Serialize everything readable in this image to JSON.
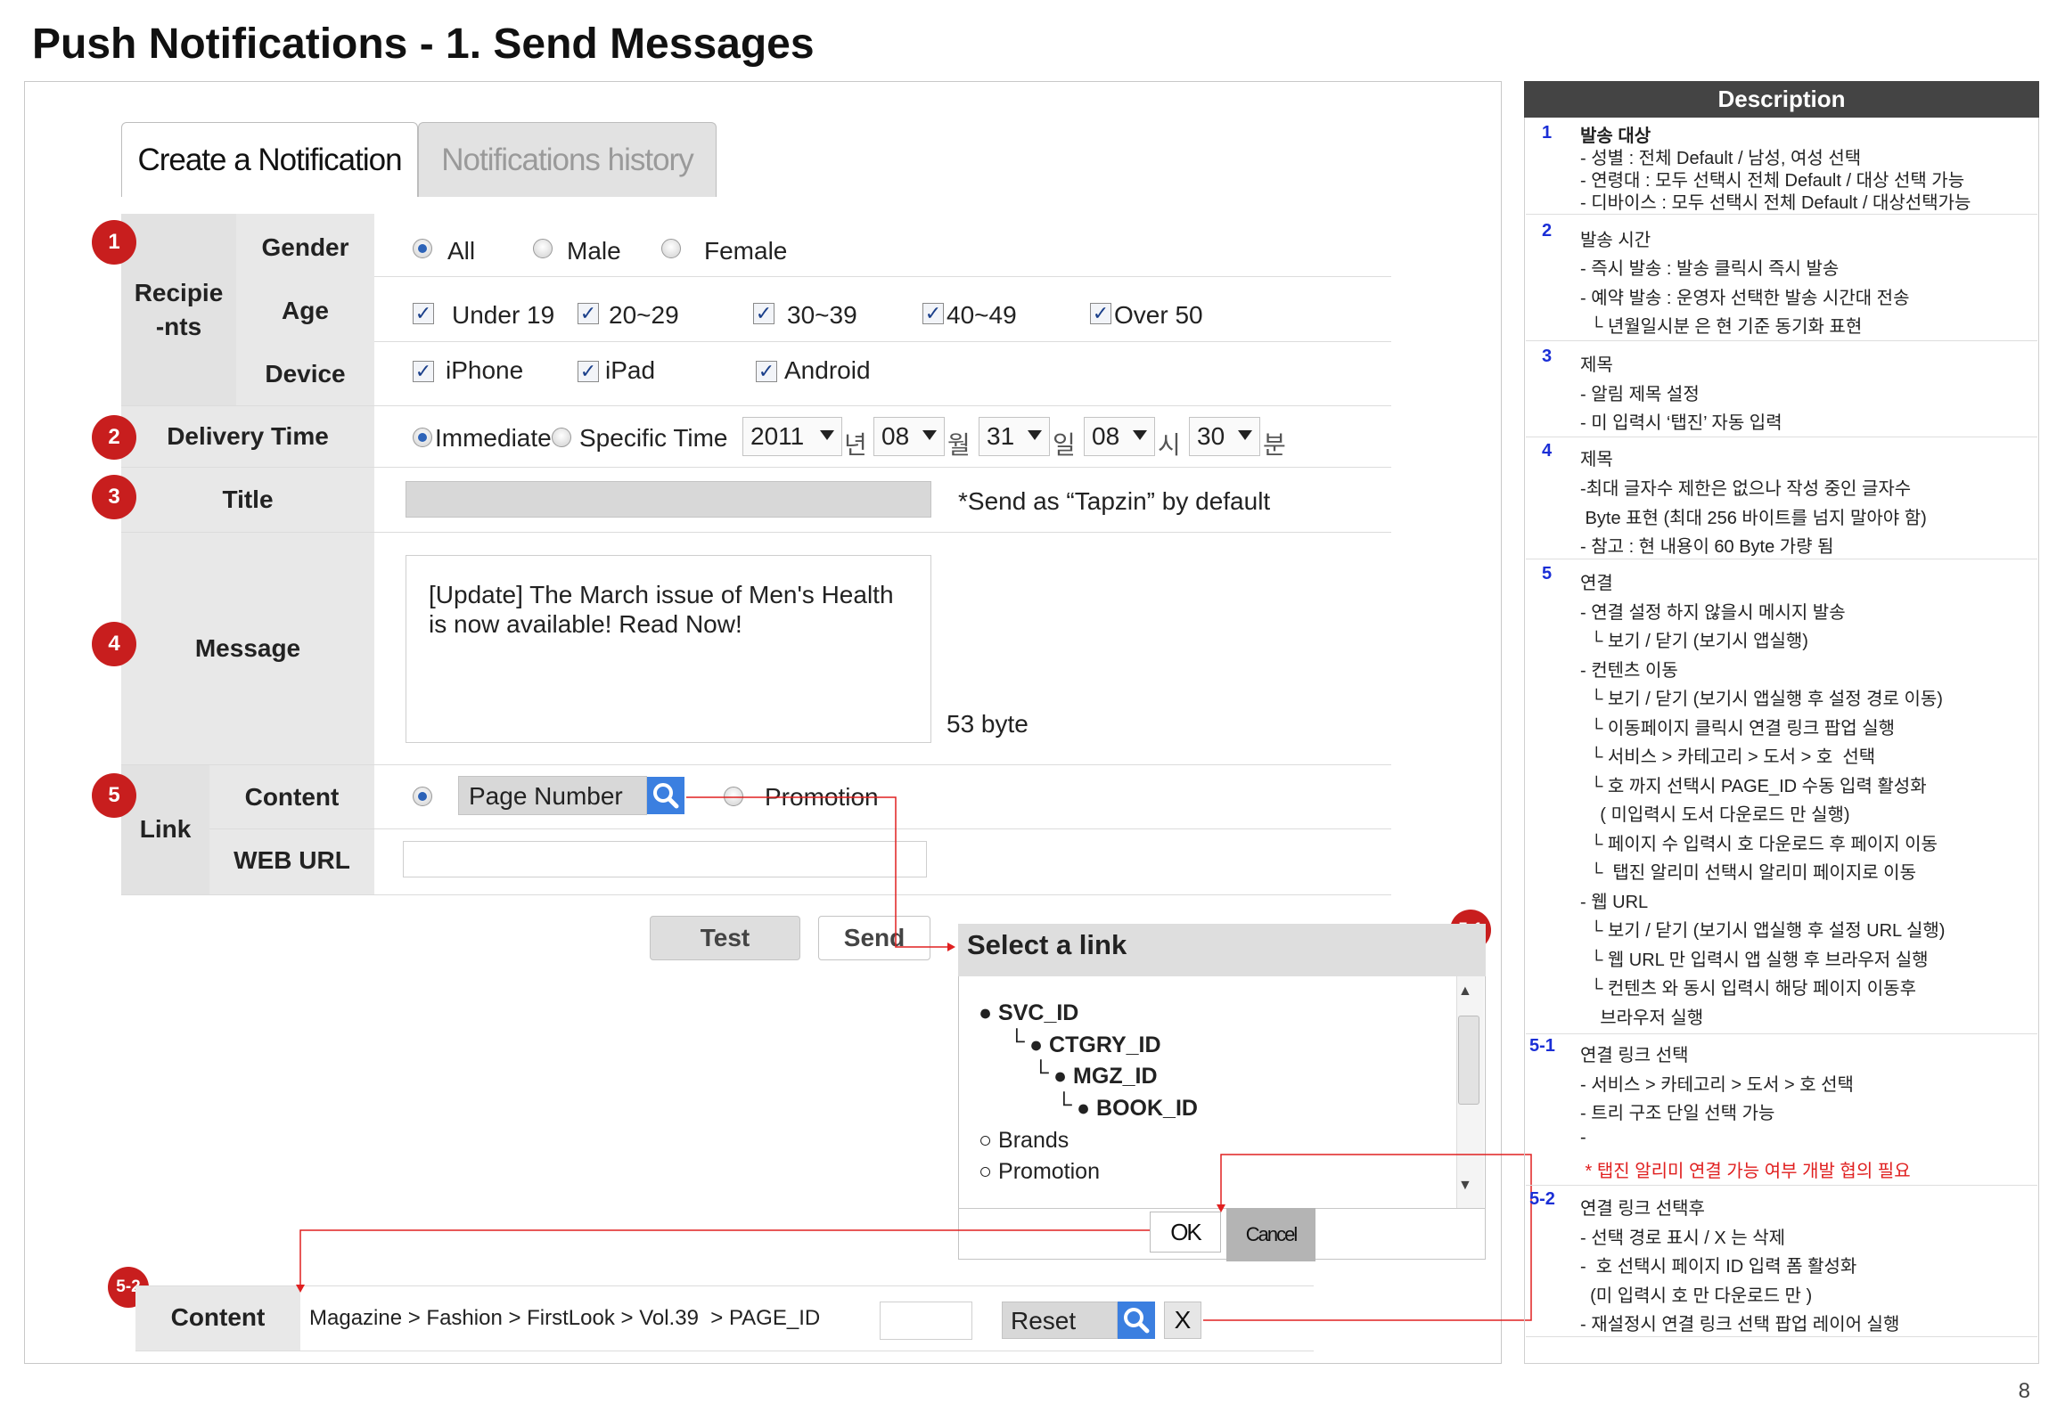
{
  "page_title": "Push Notifications - 1. Send Messages",
  "page_number": "8",
  "tabs": {
    "active": "Create a Notification",
    "inactive": "Notifications history"
  },
  "badges": {
    "n1": "1",
    "n2": "2",
    "n3": "3",
    "n4": "4",
    "n5": "5",
    "n51": "5-1",
    "n52": "5-2"
  },
  "recipients": {
    "group_label": "Recipie\n-nts",
    "gender": {
      "label": "Gender",
      "options": [
        "All",
        "Male",
        "Female"
      ],
      "selected": "All"
    },
    "age": {
      "label": "Age",
      "options": [
        "Under 19",
        "20~29",
        "30~39",
        "40~49",
        "Over 50"
      ]
    },
    "device": {
      "label": "Device",
      "options": [
        "iPhone",
        "iPad",
        "Android"
      ]
    }
  },
  "delivery": {
    "label": "Delivery Time",
    "immediate": "Immediate",
    "specific": "Specific Time",
    "year": "2011",
    "year_unit": "년",
    "month": "08",
    "month_unit": "월",
    "day": "31",
    "day_unit": "일",
    "hour": "08",
    "hour_unit": "시",
    "minute": "30",
    "minute_unit": "분"
  },
  "title_row": {
    "label": "Title",
    "note": "*Send as “Tapzin” by default"
  },
  "message": {
    "label": "Message",
    "line1": "[Update] The March issue of Men's Health",
    "line2": "is now available! Read Now!",
    "bytes": "53 byte"
  },
  "link": {
    "group_label": "Link",
    "content_label": "Content",
    "page_number": "Page Number",
    "promotion": "Promotion",
    "web_url_label": "WEB URL"
  },
  "buttons": {
    "test": "Test",
    "send": "Send"
  },
  "popup": {
    "title": "Select a link",
    "svc": "● SVC_ID",
    "ctgry": "● CTGRY_ID",
    "mgz": "● MGZ_ID",
    "book": "● BOOK_ID",
    "tree_mark": "└",
    "brands": "○ Brands",
    "promotion": "○ Promotion",
    "ok": "OK",
    "cancel": "Cancel"
  },
  "content_result": {
    "label": "Content",
    "path": "Magazine > Fashion > FirstLook > Vol.39  > PAGE_ID",
    "reset": "Reset",
    "x": "X"
  },
  "description": {
    "heading": "Description",
    "sections": [
      {
        "num": "1",
        "lines": [
          "발송 대상",
          "- 성별 : 전체 Default / 남성, 여성 선택",
          "- 연령대 : 모두 선택시 전체 Default / 대상 선택 가능",
          "- 디바이스 : 모두 선택시 전체 Default / 대상선택가능"
        ]
      },
      {
        "num": "2",
        "lines": [
          "발송 시간",
          "- 즉시 발송 : 발송 클릭시 즉시 발송",
          "- 예약 발송 : 운영자 선택한 발송 시간대 전송",
          "  └ 년월일시분 은 현 기준 동기화 표현"
        ]
      },
      {
        "num": "3",
        "lines": [
          "제목",
          "- 알림 제목 설정",
          "- 미 입력시 ‘탭진’ 자동 입력"
        ]
      },
      {
        "num": "4",
        "lines": [
          "제목",
          "-최대 글자수 제한은 없으나 작성 중인 글자수",
          " Byte 표현 (최대 256 바이트를 넘지 말아야 함)",
          "- 참고 : 현 내용이 60 Byte 가량 됨"
        ]
      },
      {
        "num": "5",
        "lines": [
          "연결",
          "- 연결 설정 하지 않을시 메시지 발송",
          "  └ 보기 / 닫기 (보기시 앱실행)",
          "- 컨텐츠 이동",
          "  └ 보기 / 닫기 (보기시 앱실행 후 설정 경로 이동)",
          "  └ 이동페이지 클릭시 연결 링크 팝업 실행",
          "  └ 서비스 > 카테고리 > 도서 > 호  선택",
          "  └ 호 까지 선택시 PAGE_ID 수동 입력 활성화",
          "    ( 미입력시 도서 다운로드 만 실행)",
          "  └ 페이지 수 입력시 호 다운로드 후 페이지 이동",
          "  └  탭진 알리미 선택시 알리미 페이지로 이동",
          "- 웹 URL",
          "  └ 보기 / 닫기 (보기시 앱실행 후 설정 URL 실행)",
          "  └ 웹 URL 만 입력시 앱 실행 후 브라우저 실행",
          "  └ 컨텐츠 와 동시 입력시 해당 페이지 이동후",
          "    브라우저 실행"
        ]
      },
      {
        "num": "5-1",
        "lines": [
          "연결 링크 선택",
          "- 서비스 > 카테고리 > 도서 > 호 선택",
          "- 트리 구조 단일 선택 가능",
          "-"
        ],
        "red": " * 탭진 알리미 연결 가능 여부 개발 협의 필요"
      },
      {
        "num": "5-2",
        "lines": [
          "연결 링크 선택후",
          "- 선택 경로 표시 / X 는 삭제",
          "-  호 선택시 페이지 ID 입력 폼 활성화",
          "  (미 입력시 호 만 다운로드 만 )",
          "- 재설정시 연결 링크 선택 팝업 레이어 실행"
        ]
      }
    ]
  },
  "colors": {
    "badge": "#c81e1e",
    "arrow": "#e02020",
    "desc_head": "#444444",
    "desc_num": "#1b2fd6",
    "search_btn": "#3b7fe0"
  }
}
